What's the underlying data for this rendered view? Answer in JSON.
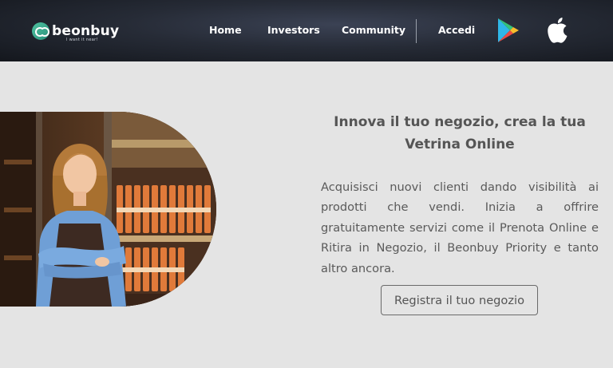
{
  "brand": {
    "name": "beonbuy",
    "tagline": "I want it near!"
  },
  "nav": {
    "items": [
      {
        "label": "Home"
      },
      {
        "label": "Investors"
      },
      {
        "label": "Community"
      },
      {
        "label": "Accedi"
      }
    ],
    "store_icons": [
      "google-play-icon",
      "apple-icon"
    ]
  },
  "hero": {
    "title": "Innova il tuo negozio, crea la tua Vetrina Online",
    "description": "Acquisisci nuovi clienti dando visibilità ai prodotti che vendi. Inizia a offrire gratuitamente servizi come il Prenota Online e Ritira in Negozio, il Beonbuy Priority e tanto altro ancora.",
    "cta_label": "Registra il tuo negozio"
  },
  "colors": {
    "navbar": "#1c2028",
    "background": "#e4e4e4",
    "text": "#555555",
    "brand_accent": "#3fb395"
  }
}
